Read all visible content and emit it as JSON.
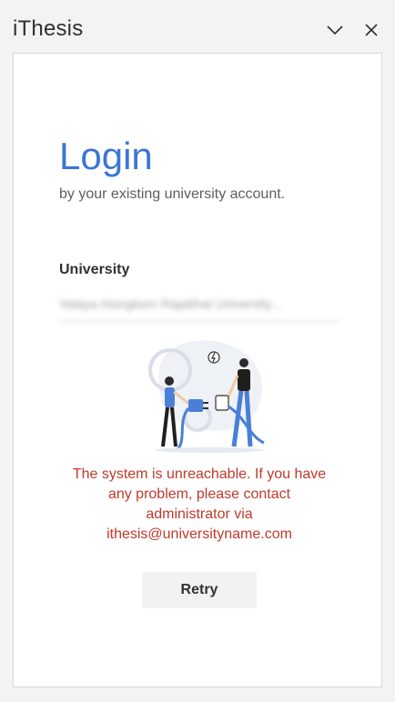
{
  "window": {
    "title": "iThesis"
  },
  "login": {
    "heading": "Login",
    "subtitle": "by your existing university account."
  },
  "university_field": {
    "label": "University",
    "value": "Valaya Alongkorn Rajabhat University..."
  },
  "error": {
    "lines": [
      "The system is unreachable. If you have",
      "any problem, please contact",
      "administrator via",
      "ithesis@universityname.com"
    ]
  },
  "actions": {
    "retry_label": "Retry"
  },
  "icons": {
    "collapse": "chevron-down-icon",
    "close": "close-icon",
    "illustration": "disconnected-plug-illustration"
  },
  "colors": {
    "heading": "#3a76d6",
    "error": "#c0392b",
    "button_bg": "#f3f2f1"
  }
}
